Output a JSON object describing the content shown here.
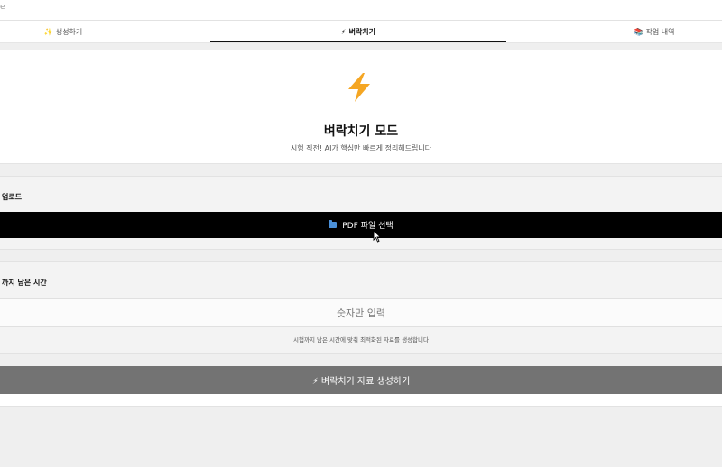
{
  "topbar": {
    "crumb": "e"
  },
  "tabs": [
    {
      "icon": "✨",
      "icon_name": "sparkles-icon",
      "label": "생성하기",
      "active": false
    },
    {
      "icon": "⚡",
      "icon_name": "lightning-icon",
      "label": "벼락치기",
      "active": true
    },
    {
      "icon": "📚",
      "icon_name": "books-icon",
      "label": "작업 내역",
      "active": false
    }
  ],
  "hero": {
    "icon_name": "lightning-bolt-icon",
    "title": "벼락치기 모드",
    "subtitle": "시험 직전! AI가 핵심만 빠르게 정리해드립니다"
  },
  "upload": {
    "label": "업로드",
    "button_label": "PDF 파일 선택",
    "button_icon_name": "folder-icon"
  },
  "time": {
    "label": "까지 남은 시간",
    "placeholder": "숫자만 입력",
    "hint": "시험까지 남은 시간에 맞춰 최적화된 자료를 생성합니다"
  },
  "generate": {
    "label": "⚡ 벼락치기 자료 생성하기"
  },
  "colors": {
    "bolt": "#f5a623",
    "primary_button": "#000000",
    "generate_button": "#737373",
    "folder": "#4a90d9"
  }
}
